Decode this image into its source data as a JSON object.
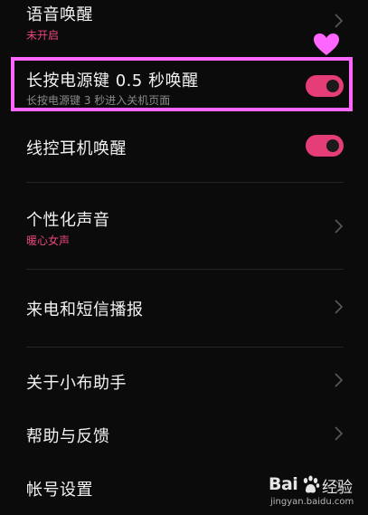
{
  "settings": {
    "voice_wakeup": {
      "title": "语音唤醒",
      "status": "未开启"
    },
    "power_key": {
      "title": "长按电源键 0.5 秒唤醒",
      "desc": "长按电源键 3 秒进入关机页面",
      "enabled": true
    },
    "wired_headset": {
      "title": "线控耳机唤醒",
      "enabled": true
    },
    "personalized_voice": {
      "title": "个性化声音",
      "value": "暖心女声"
    },
    "call_sms_broadcast": {
      "title": "来电和短信播报"
    },
    "about": {
      "title": "关于小布助手"
    },
    "help_feedback": {
      "title": "帮助与反馈"
    },
    "account": {
      "title": "帐号设置"
    }
  },
  "colors": {
    "accent": "#e43d77",
    "highlight": "#ff66ff",
    "background": "#0b0b0b"
  },
  "watermark": {
    "brand": "Bai",
    "suffix": "经验",
    "url": "jingyan.baidu.com"
  },
  "icons": [
    "chevron-right-icon",
    "heart-icon",
    "paw-icon"
  ]
}
